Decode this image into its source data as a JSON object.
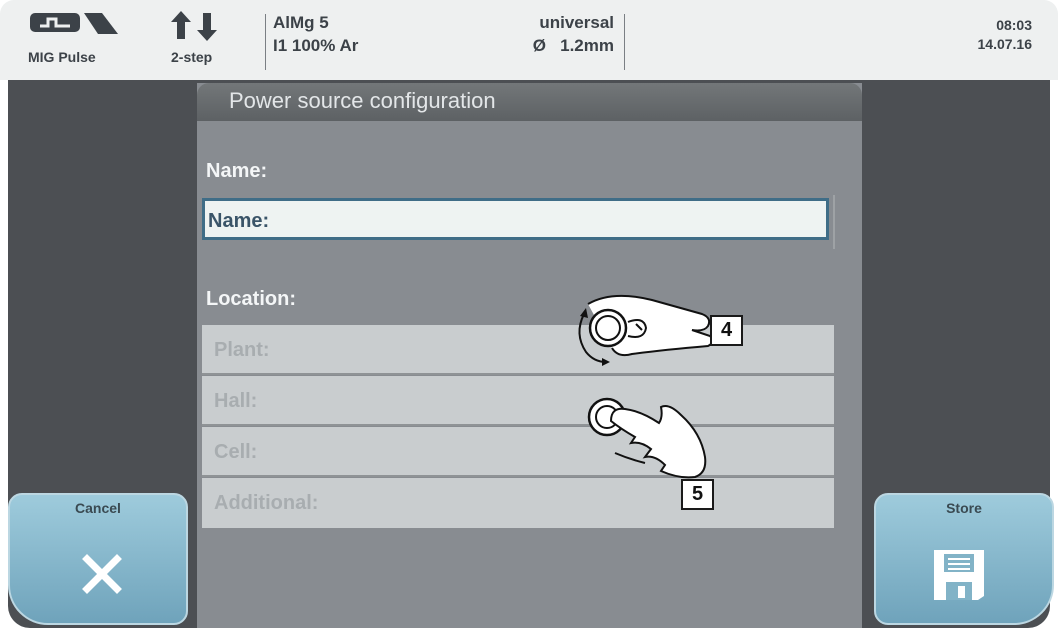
{
  "status_bar": {
    "process": "MIG Pulse",
    "mode": "2-step",
    "material": "AlMg 5",
    "gas": "I1 100% Ar",
    "characteristic": "universal",
    "diameter": "Ø   1.2mm",
    "time": "08:03",
    "date": "14.07.16"
  },
  "dialog": {
    "title": "Power source configuration",
    "name_label": "Name:",
    "name_value": "Name:",
    "location_label": "Location:",
    "location_fields": [
      "Plant:",
      "Hall:",
      "Cell:",
      "Additional:"
    ]
  },
  "buttons": {
    "cancel": "Cancel",
    "store": "Store"
  },
  "callouts": {
    "dial": "4",
    "press": "5"
  },
  "icons": {
    "process": "mig-pulse-wave-icon",
    "mode": "up-down-arrows-icon",
    "cancel": "close-x-icon",
    "store": "floppy-disk-icon",
    "dial_hand": "hand-turning-knob-icon",
    "press_hand": "hand-pressing-knob-icon"
  },
  "colors": {
    "topbar": "#eef0f0",
    "frame": "#4c4f53",
    "dialog": "#888c91",
    "button": "#8cbdd0",
    "field_border": "#3f6d87"
  }
}
